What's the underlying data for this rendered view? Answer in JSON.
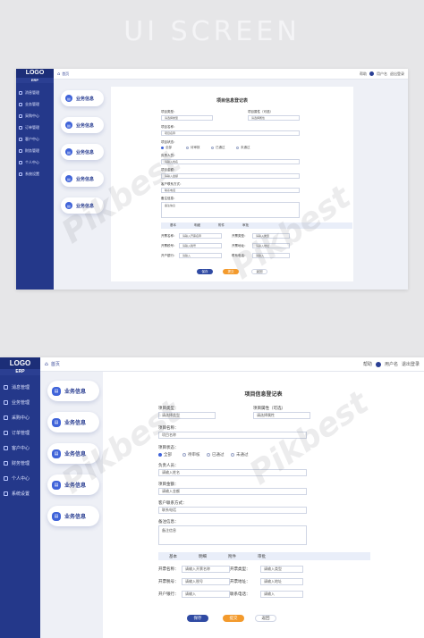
{
  "hero_title": "UI SCREEN",
  "logo": "LOGO",
  "logo_sub": "ERP",
  "sidebar_items": [
    "消息管理",
    "业务管理",
    "采购中心",
    "订单管理",
    "客户中心",
    "财务管理",
    "个人中心",
    "系统设置"
  ],
  "breadcrumb": "首页",
  "topbar": {
    "help": "帮助",
    "user": "用户名",
    "logout": "退出登录"
  },
  "cards": [
    "业务信息",
    "业务信息",
    "业务信息",
    "业务信息",
    "业务信息"
  ],
  "form": {
    "title": "项目信息登记表",
    "label_type": "项目类型：",
    "label_attr": "项目属性（可选）",
    "select_placeholder": "请选择类型",
    "select_placeholder2": "请选择属性",
    "label_name": "项目名称：",
    "name_value": "项目名称",
    "label_status": "项目状态：",
    "radios": [
      "全部",
      "待审核",
      "已通过",
      "未通过"
    ],
    "label_owner": "负责人员：",
    "owner_value": "请输入姓名",
    "label_amount": "项目金额：",
    "amount_value": "请输入金额",
    "label_contact": "客户联系方式：",
    "contact_value": "联系电话",
    "label_remark": "备注信息：",
    "remark_value": "备注信息",
    "tabs": [
      "基本",
      "明细",
      "附件",
      "审批"
    ],
    "sub_rows": [
      {
        "l1": "开票名称：",
        "v1": "请输入开票名称",
        "l2": "开票类型：",
        "v2": "请输入类型"
      },
      {
        "l1": "开票税号：",
        "v1": "请输入税号",
        "l2": "开票地址：",
        "v2": "请输入地址"
      },
      {
        "l1": "开户银行：",
        "v1": "请输入",
        "l2": "联系电话：",
        "v2": "请输入"
      }
    ],
    "btn_save": "保存",
    "btn_submit": "提交",
    "btn_cancel": "返回"
  },
  "watermark": "Pikbest",
  "colors": {
    "sidebar": "#24388a",
    "accent": "#3f63d9",
    "orange": "#f39a2c"
  },
  "icons": [
    "user-icon",
    "doc-icon",
    "cart-icon",
    "order-icon",
    "people-icon",
    "wallet-icon",
    "person-icon",
    "gear-icon"
  ]
}
